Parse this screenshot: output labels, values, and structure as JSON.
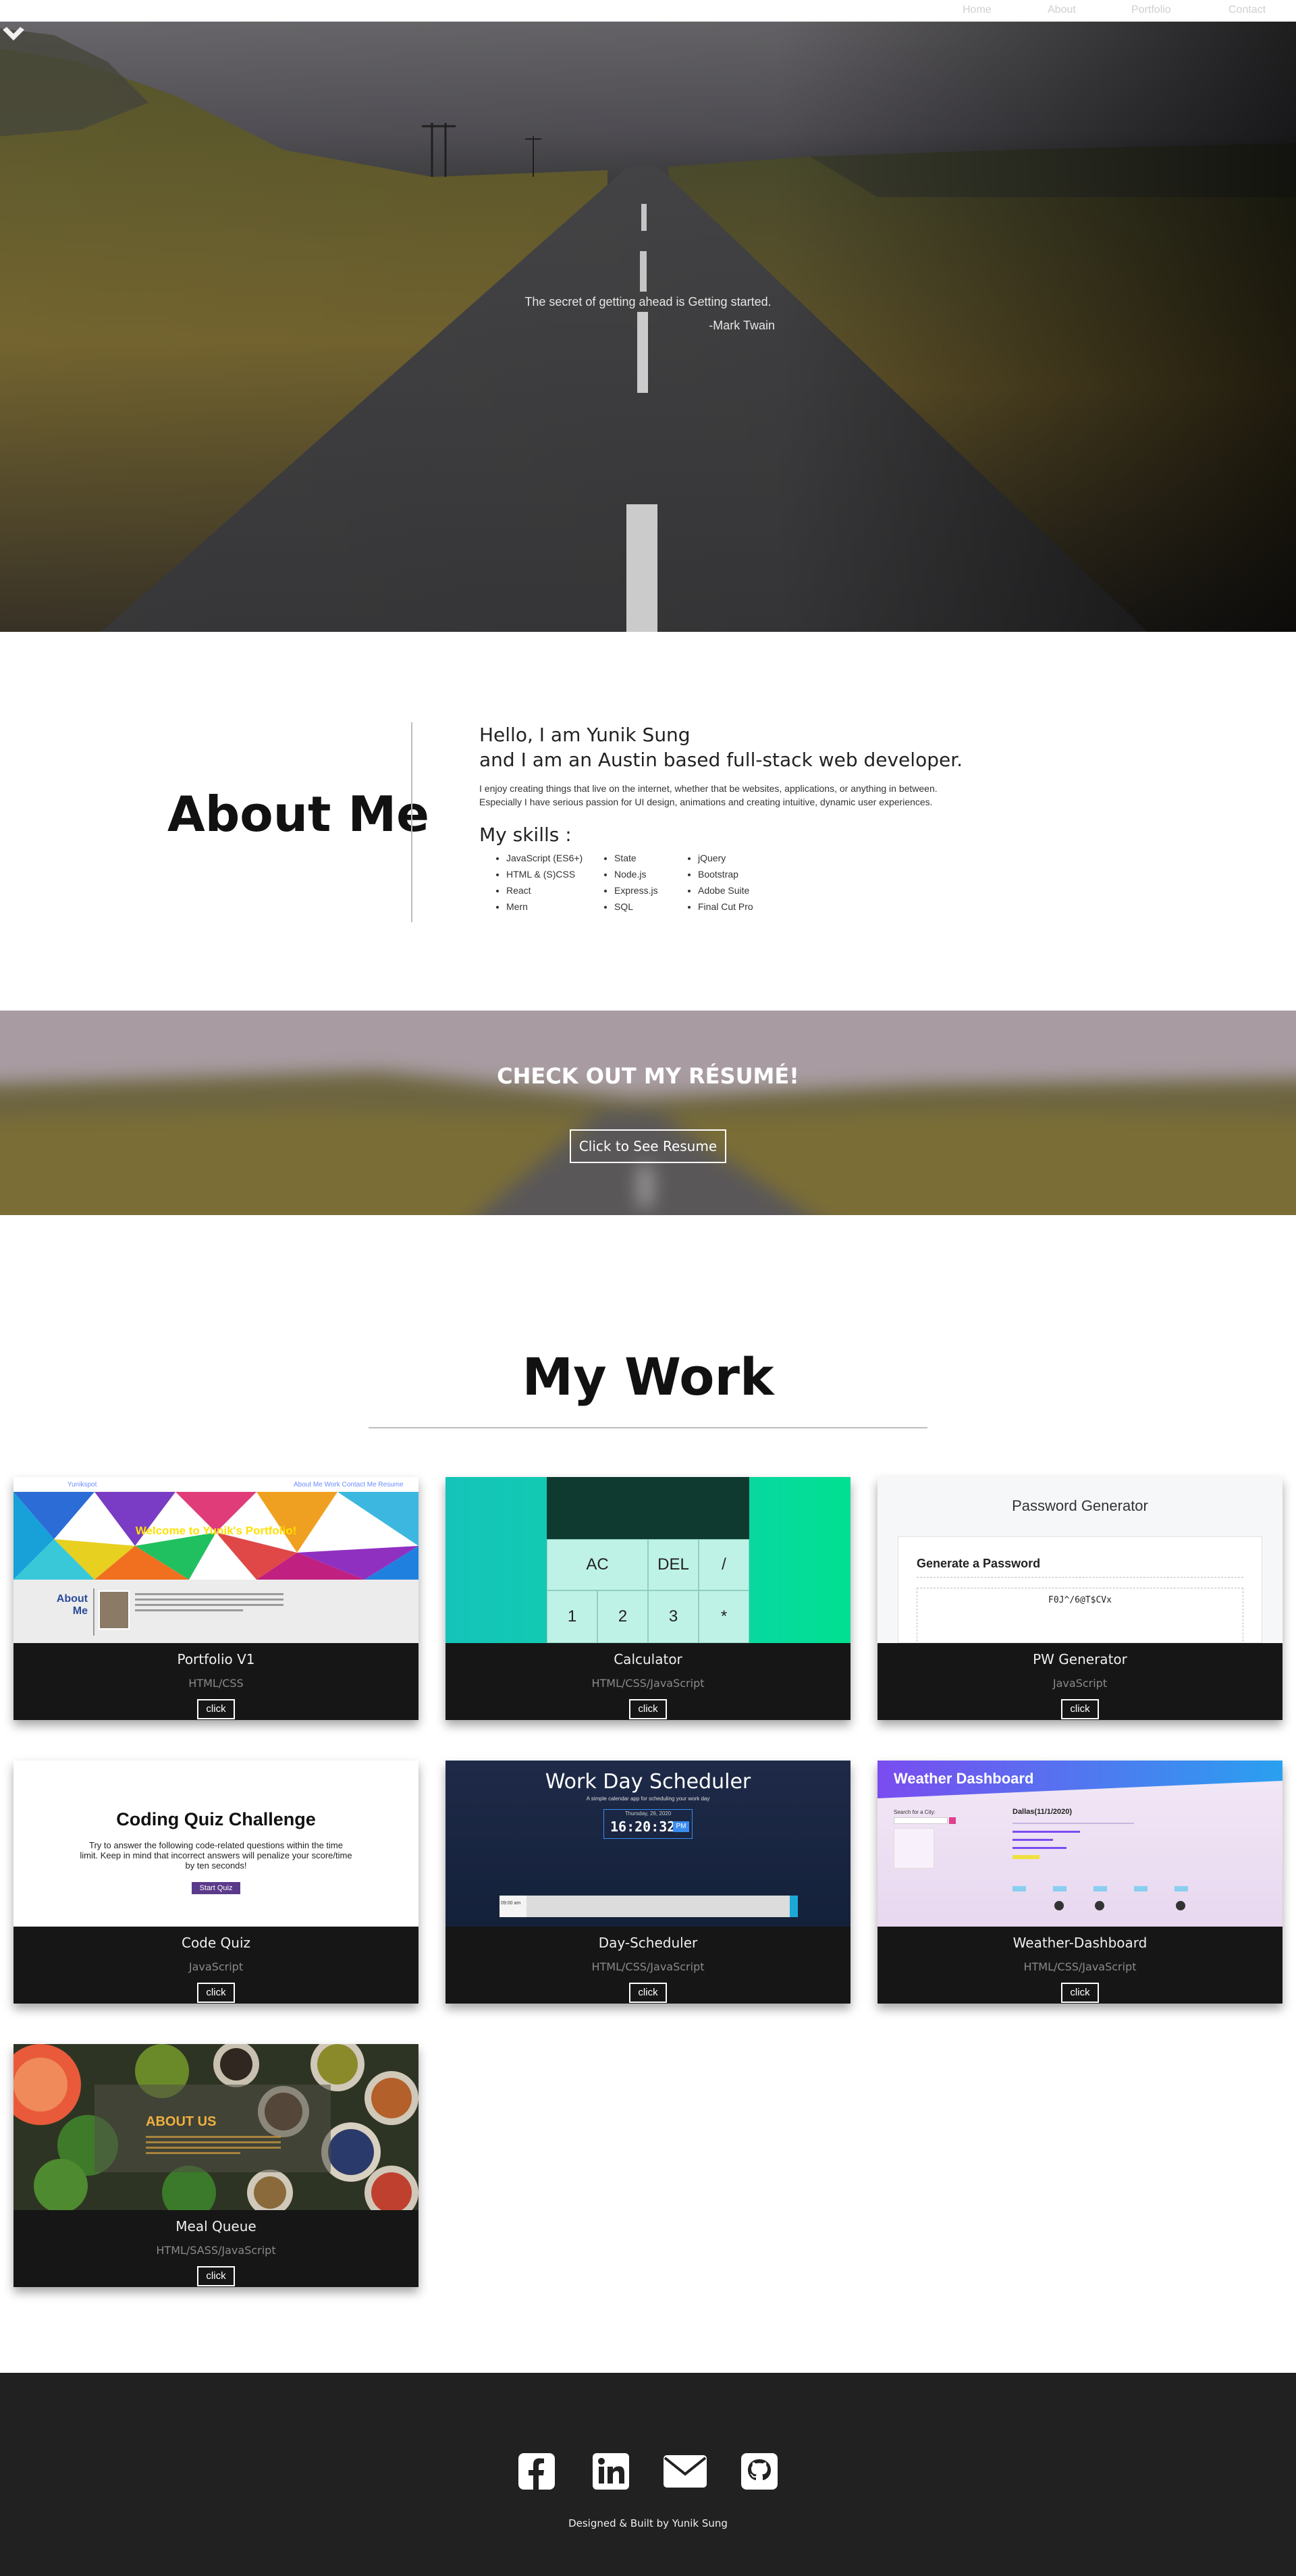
{
  "nav": {
    "items": [
      "Home",
      "About",
      "Portfolio",
      "Contact"
    ]
  },
  "hero": {
    "quote": "The secret of getting ahead is Getting started.",
    "author": "-Mark Twain"
  },
  "about": {
    "title": "About Me",
    "greeting_line1": "Hello, I am Yunik Sung",
    "greeting_line2": "and I am an Austin based full-stack web developer.",
    "intro_line1": "I enjoy creating things that live on the internet, whether that be websites, applications, or anything in between.",
    "intro_line2": "Especially I have serious passion for UI design, animations and creating intuitive, dynamic user experiences.",
    "skills_title": "My skills :",
    "skills_col1": [
      "JavaScript (ES6+)",
      "HTML & (S)CSS",
      "React",
      "Mern"
    ],
    "skills_col2": [
      "State",
      "Node.js",
      "Express.js",
      "SQL"
    ],
    "skills_col3": [
      "jQuery",
      "Bootstrap",
      "Adobe Suite",
      "Final Cut Pro"
    ]
  },
  "resume": {
    "title": "CHECK OUT MY RÉSUMÉ!",
    "button": "Click to See Resume"
  },
  "work": {
    "title": "My Work",
    "projects": [
      {
        "name": "Portfolio V1",
        "tech": "HTML/CSS",
        "button": "click",
        "preview": {
          "header": "Welcome to Yunik's Portfolio!",
          "nav_left": "Yunikspot",
          "nav_right": "About Me  Work  Contact Me  Resume",
          "about": "About Me"
        }
      },
      {
        "name": "Calculator",
        "tech": "HTML/CSS/JavaScript",
        "button": "click",
        "preview": {
          "keys_row1": [
            "AC",
            "DEL",
            "/"
          ],
          "keys_row2": [
            "1",
            "2",
            "3",
            "*"
          ]
        }
      },
      {
        "name": "PW Generator",
        "tech": "JavaScript",
        "button": "click",
        "preview": {
          "title": "Password Generator",
          "subtitle": "Generate a Password",
          "value": "F0J^/6@T$CVx"
        }
      },
      {
        "name": "Code Quiz",
        "tech": "JavaScript",
        "button": "click",
        "preview": {
          "title": "Coding Quiz Challenge",
          "line1": "Try to answer the following code-related questions within the time",
          "line2": "limit. Keep in mind that incorrect answers will penalize your score/time",
          "line3": "by ten seconds!",
          "start": "Start Quiz"
        }
      },
      {
        "name": "Day-Scheduler",
        "tech": "HTML/CSS/JavaScript",
        "button": "click",
        "preview": {
          "title": "Work Day Scheduler",
          "subtitle": "A simple calendar app for scheduling your work day",
          "date": "Thursday, 26, 2020",
          "time": "16:20:32",
          "ampm": "PM",
          "slot": "09:00 am"
        }
      },
      {
        "name": "Weather-Dashboard",
        "tech": "HTML/CSS/JavaScript",
        "button": "click",
        "preview": {
          "title": "Weather Dashboard",
          "city": "Dallas(11/1/2020)",
          "search": "Search for a City:"
        }
      },
      {
        "name": "Meal Queue",
        "tech": "HTML/SASS/JavaScript",
        "button": "click",
        "preview": {
          "title": "ABOUT US"
        }
      }
    ]
  },
  "footer": {
    "credit": "Designed & Built by Yunik Sung",
    "icons": [
      "facebook-icon",
      "linkedin-icon",
      "mail-icon",
      "github-icon"
    ]
  },
  "colors": {
    "footer_bg": "#212121",
    "card_meta_bg": "#161616",
    "calc_teal": "#14c4b8",
    "calc_green": "#00e090",
    "weather_purple": "#7a4cf0"
  }
}
